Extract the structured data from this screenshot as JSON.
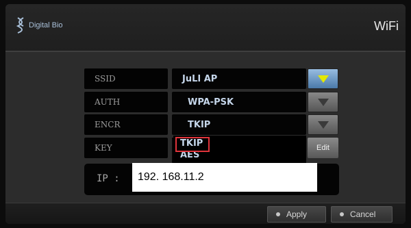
{
  "header": {
    "logo_text": "Digital Bio",
    "title": "WiFi"
  },
  "settings": {
    "ssid": {
      "label": "SSID",
      "value": "JuLI AP"
    },
    "auth": {
      "label": "AUTH",
      "value": "WPA-PSK"
    },
    "encr": {
      "label": "ENCR",
      "value": "TKIP"
    },
    "key": {
      "label": "KEY"
    }
  },
  "encr_dropdown": {
    "options": [
      "TKIP",
      "AES"
    ],
    "highlighted": "TKIP"
  },
  "edit_label": "Edit",
  "ip": {
    "label": "IP  :",
    "value": "192. 168.11.2"
  },
  "footer": {
    "apply_label": "Apply",
    "cancel_label": "Cancel"
  },
  "icons": {
    "dropdown_arrow": "triangle-down-icon",
    "logo": "dna-helix-icon"
  },
  "colors": {
    "active_arrow": "#e3e800",
    "highlight_border": "#e0343b",
    "value_text": "#c5d6ea"
  }
}
